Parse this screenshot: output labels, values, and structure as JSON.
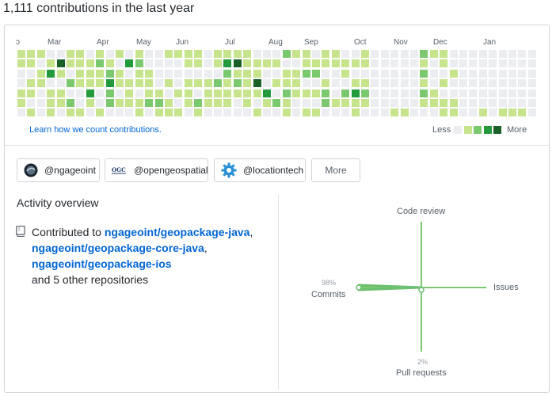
{
  "heading": "1,111 contributions in the last year",
  "months": [
    "ɔ",
    "Mar",
    "Apr",
    "May",
    "Jun",
    "Jul",
    "Aug",
    "Sep",
    "Oct",
    "Nov",
    "Dec",
    "Jan"
  ],
  "learn_link": "Learn how we count contributions.",
  "legend": {
    "less": "Less",
    "more": "More"
  },
  "colors": {
    "empty": "#ebedf0",
    "l1": "#c6e48b",
    "l2": "#7bc96f",
    "l3": "#239a3b",
    "l4": "#196127",
    "link": "#0366d6",
    "radar": "#6cc070"
  },
  "orgs": [
    {
      "label": "@ngageoint",
      "icon": "ngageoint-logo-icon"
    },
    {
      "label": "@opengeospatial",
      "icon": "ogc-logo-icon"
    },
    {
      "label": "@locationtech",
      "icon": "locationtech-gear-icon"
    }
  ],
  "more_button": "More",
  "activity": {
    "title": "Activity overview",
    "prefix": "Contributed to",
    "repos": [
      "ngageoint/geopackage-java",
      "ngageoint/geopackage-core-java",
      "ngageoint/geopackage-ios"
    ],
    "sep": ",",
    "suffix": "and 5 other repositories"
  },
  "radar": {
    "code_review": "Code review",
    "issues": "Issues",
    "commits": "Commits",
    "commits_pct": "98%",
    "pull_requests": "Pull requests",
    "pull_requests_pct": "2%"
  }
}
